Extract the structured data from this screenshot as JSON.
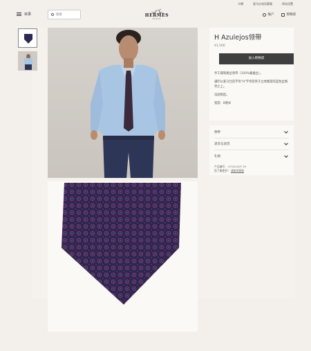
{
  "topbar": {
    "links": [
      "卡赠",
      "爱马仕电话客服",
      "网站设置"
    ]
  },
  "header": {
    "menu_label": "目录",
    "search_placeholder": "搜索",
    "logo_text": "HERMÈS",
    "logo_sub": "PARIS",
    "account_label": "账户",
    "cart_label": "购物袋"
  },
  "product": {
    "title": "H Azulejos领带",
    "price": "¥1,500",
    "add_to_cart": "加入购物袋",
    "description": [
      "手工缝制真丝领带（100%桑蚕丝）。",
      "满印以爱马仕首字母\"H\"字母装饰于立体图案的蓝色丝绸单之上。",
      "法国制造。",
      "宽度：8厘米"
    ]
  },
  "accordion": {
    "items": [
      "保养",
      "退货与退货",
      "礼物"
    ],
    "detail_ref_label": "产品编号：",
    "detail_ref_value": "H720100T 29",
    "detail_help": "您了解更多？",
    "detail_link": "请联系客服"
  },
  "colors": {
    "button": "#3f3f3f",
    "tie": "#2d2a52",
    "shirt": "#a9c5e4",
    "background": "#f3efea"
  }
}
